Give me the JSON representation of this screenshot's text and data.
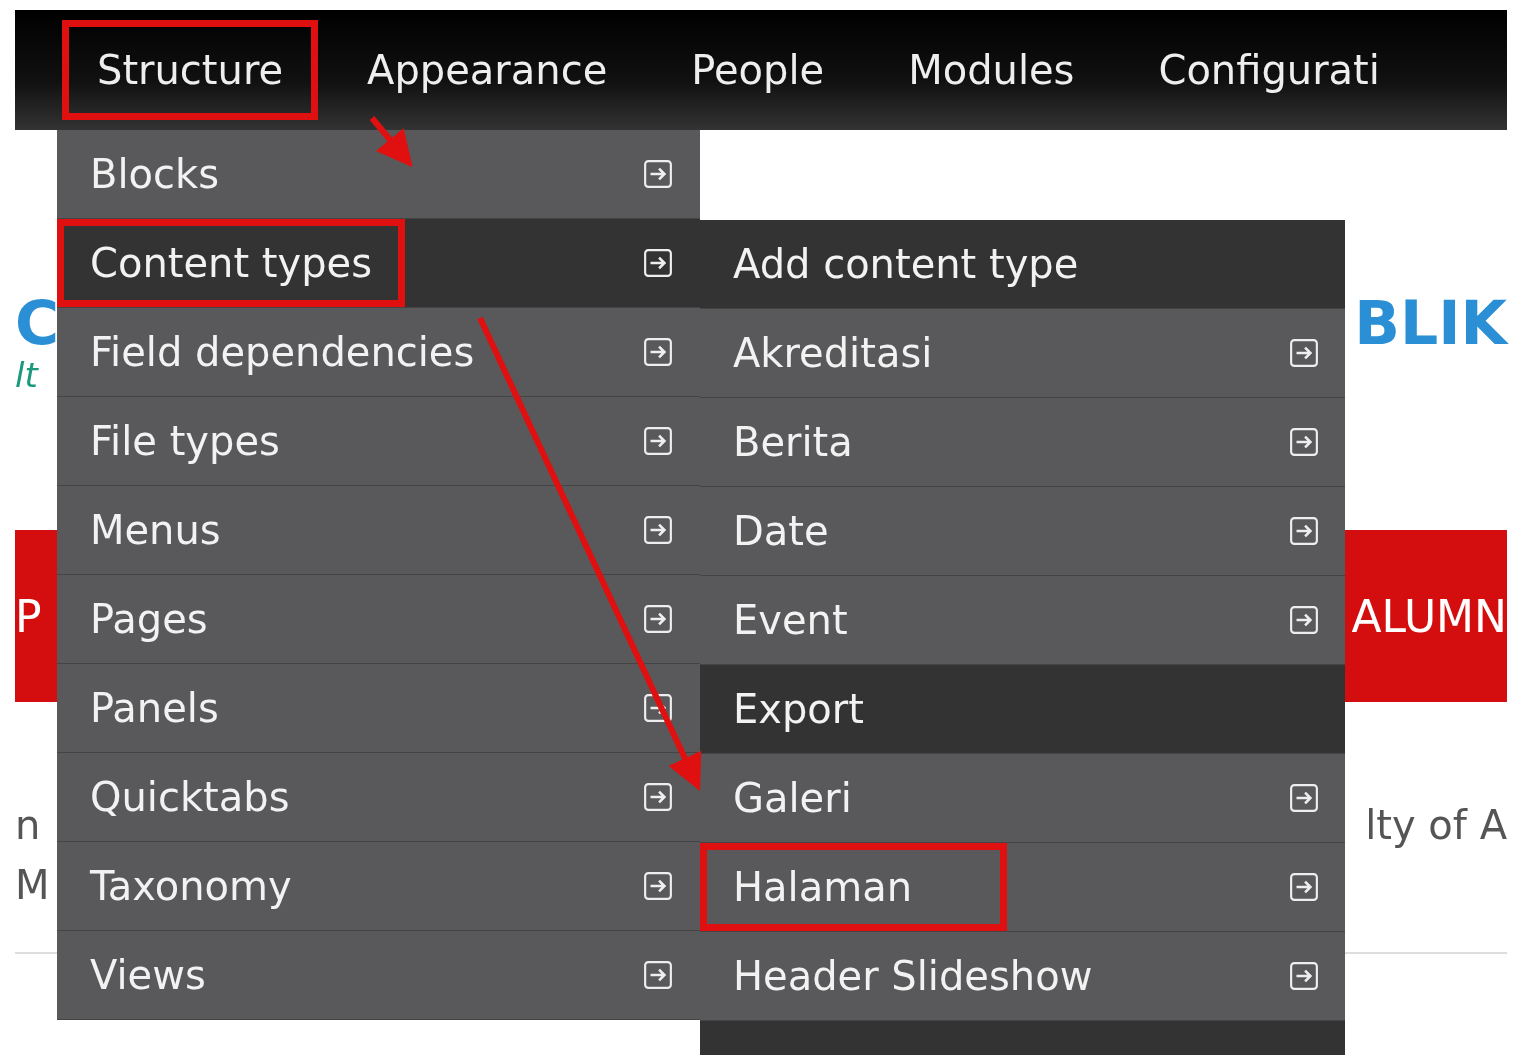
{
  "toolbar": {
    "items": [
      {
        "label": "Structure",
        "annotated": true
      },
      {
        "label": "Appearance",
        "annotated": false
      },
      {
        "label": "People",
        "annotated": false
      },
      {
        "label": "Modules",
        "annotated": false
      },
      {
        "label": "Configurati",
        "annotated": false
      }
    ]
  },
  "page": {
    "heading_left": "C",
    "heading_right": "BLIK",
    "subtitle_left": "lt",
    "nav_left": "P",
    "nav_right": "ALUMN",
    "news_left": "n",
    "news_right": "lty of A",
    "news_left_2": "M"
  },
  "structure_menu": {
    "items": [
      {
        "label": "Blocks",
        "selected": false,
        "annotated": false
      },
      {
        "label": "Content types",
        "selected": true,
        "annotated": true
      },
      {
        "label": "Field dependencies",
        "selected": false,
        "annotated": false
      },
      {
        "label": "File types",
        "selected": false,
        "annotated": false
      },
      {
        "label": "Menus",
        "selected": false,
        "annotated": false
      },
      {
        "label": "Pages",
        "selected": false,
        "annotated": false
      },
      {
        "label": "Panels",
        "selected": false,
        "annotated": false
      },
      {
        "label": "Quicktabs",
        "selected": false,
        "annotated": false
      },
      {
        "label": "Taxonomy",
        "selected": false,
        "annotated": false
      },
      {
        "label": "Views",
        "selected": false,
        "annotated": false
      }
    ]
  },
  "content_types_menu": {
    "items": [
      {
        "label": "Add content type",
        "kind": "action",
        "annotated": false
      },
      {
        "label": "Akreditasi",
        "kind": "type",
        "annotated": false
      },
      {
        "label": "Berita",
        "kind": "type",
        "annotated": false
      },
      {
        "label": "Date",
        "kind": "type",
        "annotated": false
      },
      {
        "label": "Event",
        "kind": "type",
        "annotated": false
      },
      {
        "label": "Export",
        "kind": "action",
        "annotated": false
      },
      {
        "label": "Galeri",
        "kind": "type",
        "annotated": false
      },
      {
        "label": "Halaman",
        "kind": "type",
        "annotated": true
      },
      {
        "label": "Header Slideshow",
        "kind": "type",
        "annotated": false
      }
    ]
  }
}
